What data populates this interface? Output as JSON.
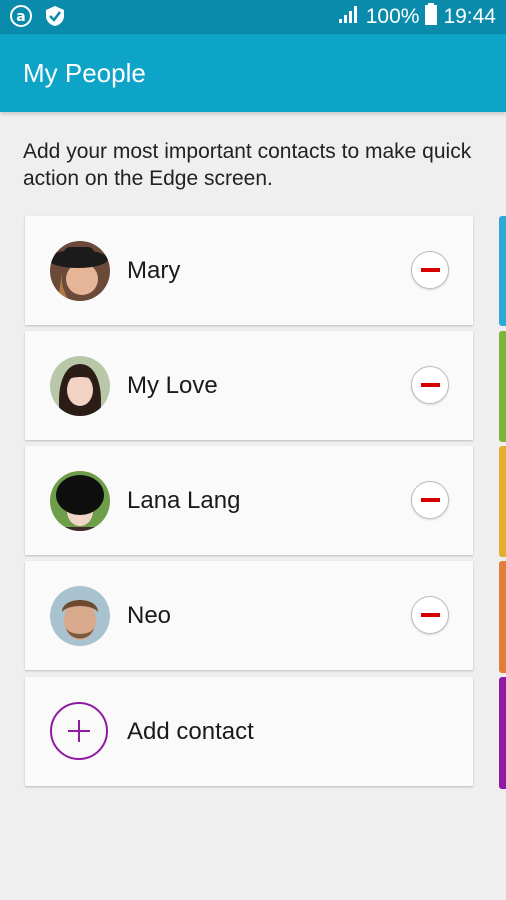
{
  "status_bar": {
    "battery": "100%",
    "time": "19:44",
    "icons": [
      "notification-a-icon",
      "shield-check-icon",
      "signal-icon",
      "battery-icon"
    ]
  },
  "app_bar": {
    "title": "My People"
  },
  "description": "Add your most important contacts to make quick action on the Edge screen.",
  "contacts": [
    {
      "name": "Mary"
    },
    {
      "name": "My Love"
    },
    {
      "name": "Lana Lang"
    },
    {
      "name": "Neo"
    }
  ],
  "add_contact": {
    "label": "Add contact"
  },
  "colors": {
    "status_bar": "#0a8bab",
    "app_bar": "#0ea4c7",
    "remove": "#d60000",
    "add_accent": "#8e1ba1",
    "edge_tabs": [
      "#2fa9d8",
      "#7bb63b",
      "#e5ad2f",
      "#e07f3c",
      "#8e1ba1"
    ]
  }
}
